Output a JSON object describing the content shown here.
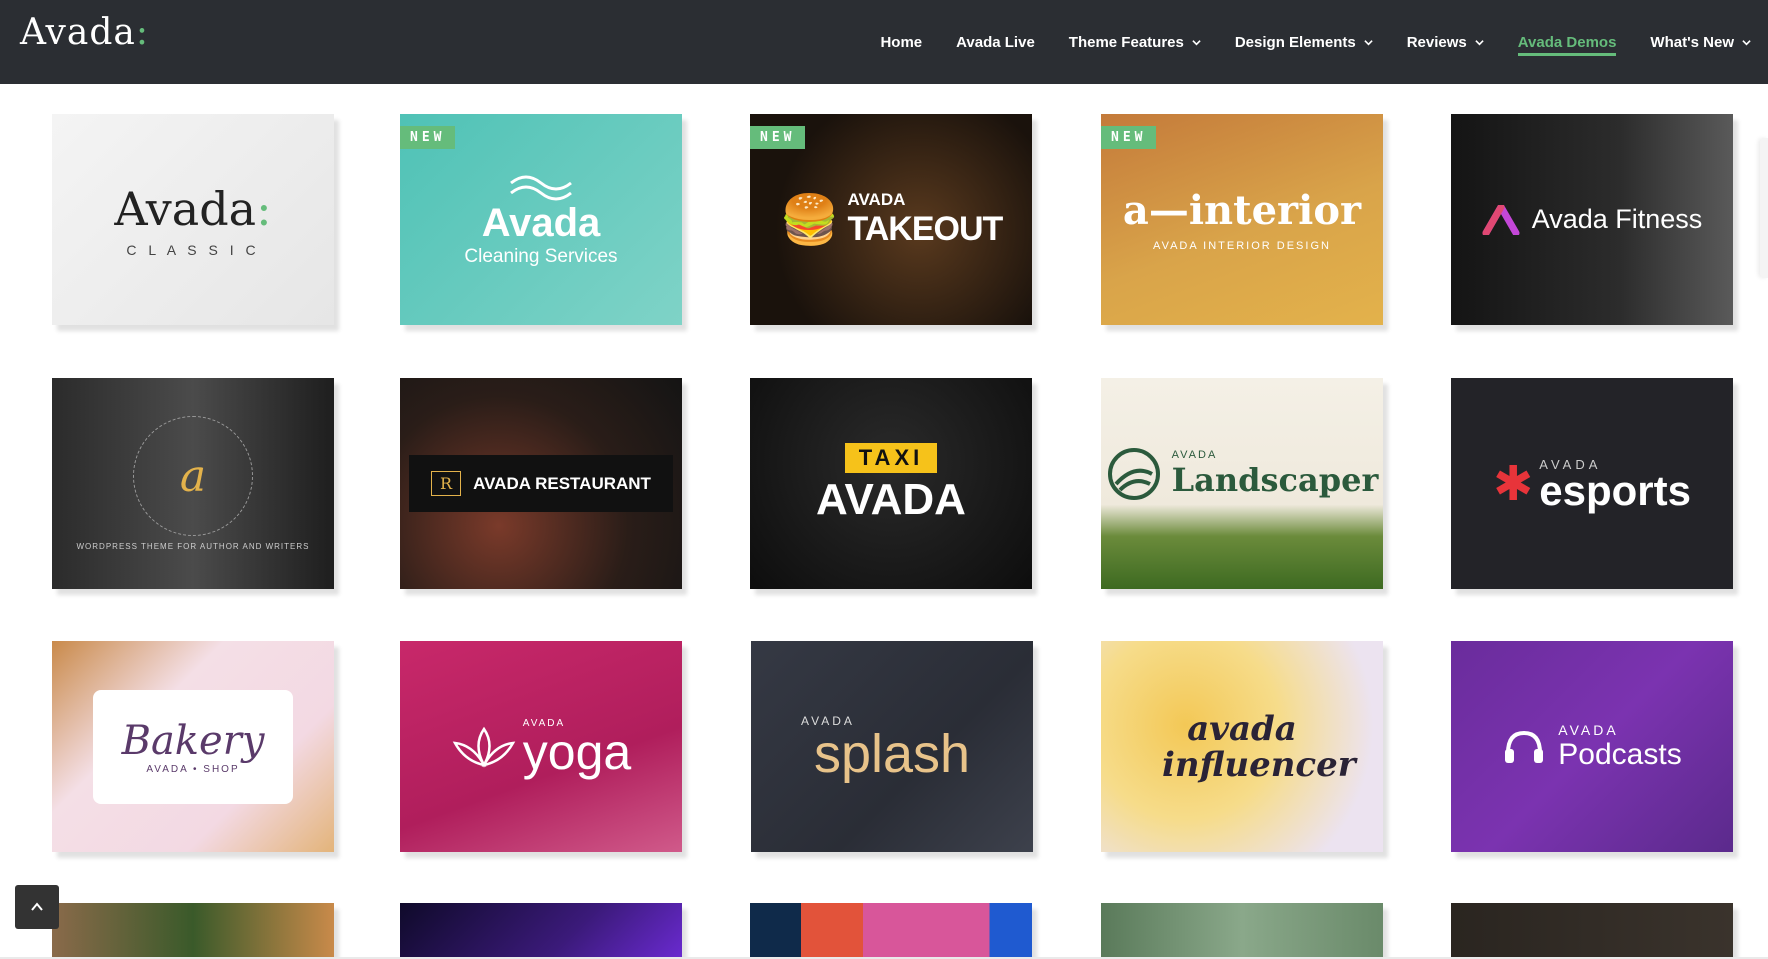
{
  "header": {
    "logo": {
      "text": "Avada",
      "suffix": ":"
    },
    "nav": [
      {
        "label": "Home",
        "dropdown": false,
        "active": false
      },
      {
        "label": "Avada Live",
        "dropdown": false,
        "active": false
      },
      {
        "label": "Theme Features",
        "dropdown": true,
        "active": false
      },
      {
        "label": "Design Elements",
        "dropdown": true,
        "active": false
      },
      {
        "label": "Reviews",
        "dropdown": true,
        "active": false
      },
      {
        "label": "Avada Demos",
        "dropdown": false,
        "active": true
      },
      {
        "label": "What's New",
        "dropdown": true,
        "active": false
      }
    ]
  },
  "demos": [
    {
      "id": "classic",
      "title": "Avada",
      "suffix": ":",
      "subtitle": "C L A S S I C",
      "badge": ""
    },
    {
      "id": "cleaning",
      "title": "Avada",
      "subtitle": "Cleaning Services",
      "badge": "NEW"
    },
    {
      "id": "takeout",
      "title": "TAKEOUT",
      "subtitle": "AVADA",
      "badge": "NEW"
    },
    {
      "id": "interior",
      "title": "a—interior",
      "subtitle": "AVADA INTERIOR DESIGN",
      "badge": "NEW"
    },
    {
      "id": "fitness",
      "title": "Avada Fitness",
      "subtitle": "",
      "badge": ""
    },
    {
      "id": "author",
      "title": "a",
      "subtitle": "WORDPRESS THEME FOR AUTHOR AND WRITERS",
      "badge": ""
    },
    {
      "id": "restaurant",
      "title": "AVADA RESTAURANT",
      "subtitle": "R",
      "badge": ""
    },
    {
      "id": "taxi",
      "title": "AVADA",
      "subtitle": "TAXI",
      "badge": ""
    },
    {
      "id": "landscaper",
      "title": "Landscaper",
      "subtitle": "AVADA",
      "badge": ""
    },
    {
      "id": "esports",
      "title": "esports",
      "subtitle": "AVADA",
      "badge": ""
    },
    {
      "id": "bakery",
      "title": "Bakery",
      "subtitle": "AVADA • SHOP",
      "badge": ""
    },
    {
      "id": "yoga",
      "title": "yoga",
      "subtitle": "AVADA",
      "badge": ""
    },
    {
      "id": "splash",
      "title": "splash",
      "subtitle": "AVADA",
      "badge": ""
    },
    {
      "id": "influencer",
      "title": "avada influencer",
      "subtitle": "",
      "badge": ""
    },
    {
      "id": "podcasts",
      "title": "Podcasts",
      "subtitle": "AVADA",
      "badge": ""
    }
  ],
  "colors": {
    "header_bg": "#2b2e33",
    "accent": "#65bc7b",
    "nav_text": "#ffffff"
  },
  "icons": {
    "scroll_top": "chevron-up-icon",
    "nav_dropdown": "chevron-down-icon"
  }
}
